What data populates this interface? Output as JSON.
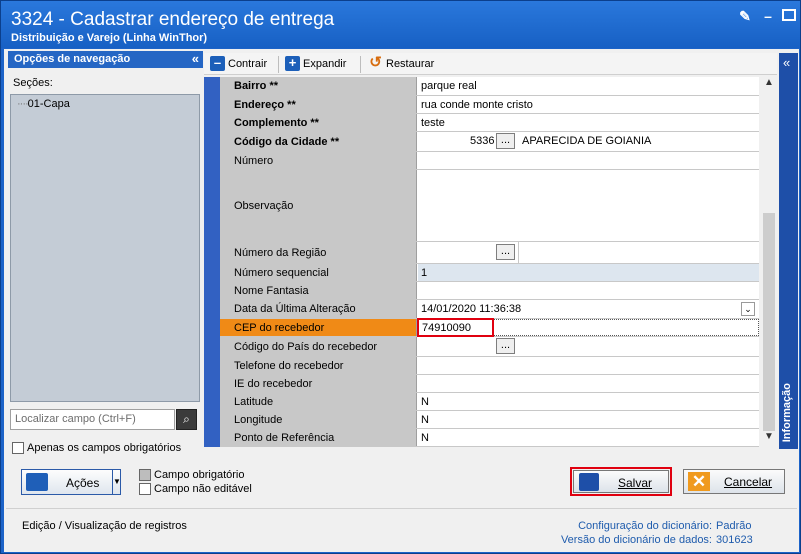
{
  "window": {
    "title": "3324 - Cadastrar endereço de entrega",
    "subtitle": "Distribuição e Varejo (Linha WinThor)"
  },
  "nav": {
    "header": "Opções de navegação",
    "sections_label": "Seções:",
    "tree_item": "01-Capa",
    "search_placeholder": "Localizar campo (Ctrl+F)",
    "only_required": "Apenas os campos obrigatórios"
  },
  "toolbar": {
    "collapse": "Contrair",
    "expand": "Expandir",
    "restore": "Restaurar"
  },
  "fields": [
    {
      "label": "Bairro **",
      "value": "parque real",
      "bold": true
    },
    {
      "label": "Endereço **",
      "value": "rua conde monte cristo",
      "bold": true
    },
    {
      "label": "Complemento **",
      "value": "teste",
      "bold": true
    },
    {
      "label": "Código da Cidade **",
      "code": "5336",
      "value": "APARECIDA DE GOIANIA",
      "bold": true
    },
    {
      "label": "Número",
      "value": ""
    },
    {
      "label": "Observação",
      "value": ""
    },
    {
      "label": "Número da Região",
      "value": ""
    },
    {
      "label": "Número sequencial",
      "value": "1"
    },
    {
      "label": "Nome Fantasia",
      "value": ""
    },
    {
      "label": "Data da Última Alteração",
      "value": "14/01/2020 11:36:38"
    },
    {
      "label": "CEP do recebedor",
      "value": "74910090"
    },
    {
      "label": "Código do País do recebedor",
      "value": ""
    },
    {
      "label": "Telefone do recebedor",
      "value": ""
    },
    {
      "label": "IE do recebedor",
      "value": ""
    },
    {
      "label": "Latitude",
      "value": "N"
    },
    {
      "label": "Longitude",
      "value": "N"
    },
    {
      "label": "Ponto de Referência",
      "value": "N"
    }
  ],
  "side_tab": "Informação",
  "buttons": {
    "actions": "Ações",
    "save": "Salvar",
    "cancel": "Cancelar"
  },
  "legend": {
    "required": "Campo obrigatório",
    "readonly": "Campo não editável"
  },
  "status": {
    "mode": "Edição / Visualização de registros",
    "dict_config_label": "Configuração do dicionário:",
    "dict_config_value": "Padrão",
    "dict_version_label": "Versão do dicionário de dados:",
    "dict_version_value": "301623"
  },
  "colors": {
    "accent": "#1c63c8",
    "highlight": "#f08a16",
    "required_box": "#e0000f"
  }
}
